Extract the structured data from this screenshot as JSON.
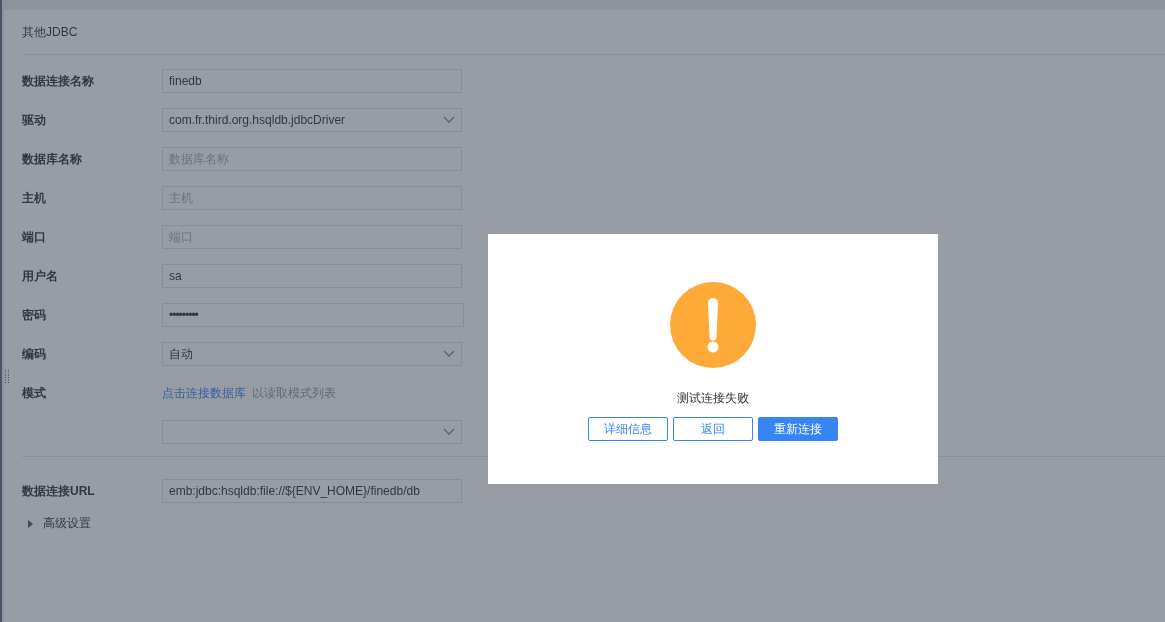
{
  "panel": {
    "title": "其他JDBC"
  },
  "fields": [
    {
      "label": "数据连接名称",
      "kind": "text",
      "value": "finedb"
    },
    {
      "label": "驱动",
      "kind": "select",
      "value": "com.fr.third.org.hsqldb.jdbcDriver"
    },
    {
      "label": "数据库名称",
      "kind": "text",
      "placeholder": "数据库名称"
    },
    {
      "label": "主机",
      "kind": "text",
      "placeholder": "主机"
    },
    {
      "label": "端口",
      "kind": "text",
      "placeholder": "端口"
    },
    {
      "label": "用户名",
      "kind": "text",
      "value": "sa"
    },
    {
      "label": "密码",
      "kind": "password",
      "value": "•••••••••"
    },
    {
      "label": "编码",
      "kind": "select",
      "value": "自动"
    }
  ],
  "schema": {
    "label": "模式",
    "link": "点击连接数据库",
    "hint": "以读取模式列表"
  },
  "url": {
    "label": "数据连接URL",
    "value": "emb:jdbc:hsqldb:file://${ENV_HOME}/finedb/db"
  },
  "advanced": {
    "label": "高级设置",
    "expanded": false
  },
  "dialog": {
    "message": "测试连接失败",
    "buttons": [
      {
        "label": "详细信息",
        "primary": false
      },
      {
        "label": "返回",
        "primary": false
      },
      {
        "label": "重新连接",
        "primary": true
      }
    ]
  }
}
